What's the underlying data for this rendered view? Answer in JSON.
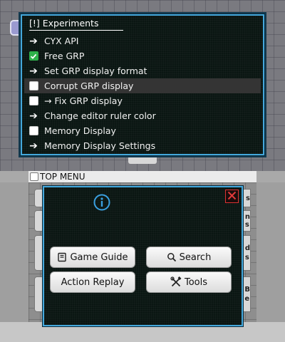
{
  "top_menu": {
    "title": "[!] Experiments",
    "items": [
      {
        "label": "CYX API",
        "marker": "arrow",
        "icon": "arrow-right-icon",
        "selected": false
      },
      {
        "label": "Free GRP",
        "marker": "checkbox",
        "checked": true,
        "selected": false
      },
      {
        "label": "Set GRP display format",
        "marker": "arrow",
        "icon": "arrow-right-icon",
        "selected": false
      },
      {
        "label": "Corrupt GRP display",
        "marker": "checkbox",
        "checked": false,
        "selected": true
      },
      {
        "label": "→ Fix GRP display",
        "marker": "checkbox",
        "checked": false,
        "selected": false
      },
      {
        "label": "Change editor ruler color",
        "marker": "arrow",
        "icon": "arrow-right-icon",
        "selected": false
      },
      {
        "label": "Memory Display",
        "marker": "checkbox",
        "checked": false,
        "selected": false
      },
      {
        "label": "Memory Display Settings",
        "marker": "arrow",
        "icon": "arrow-right-icon",
        "selected": false
      }
    ]
  },
  "bottom": {
    "topmenu_label": "TOP MENU",
    "popup": {
      "info_icon": "info-icon",
      "close_icon": "close-icon",
      "buttons": {
        "game_guide": {
          "label": "Game Guide",
          "icon": "book-icon"
        },
        "search": {
          "label": "Search",
          "icon": "search-icon"
        },
        "action_replay": {
          "label": "Action Replay"
        },
        "tools": {
          "label": "Tools",
          "icon": "tools-icon"
        }
      }
    },
    "background_button_fragments": [
      "s",
      "n\ns",
      "d\ns",
      "B\ne"
    ]
  },
  "colors": {
    "panel_border": "#44a8dc",
    "panel_bg": "#0a1612",
    "selected_row": "#343434",
    "checkbox_checked": "#2eb14a",
    "close_red": "#d33333",
    "info_blue": "#3aa0e0"
  }
}
